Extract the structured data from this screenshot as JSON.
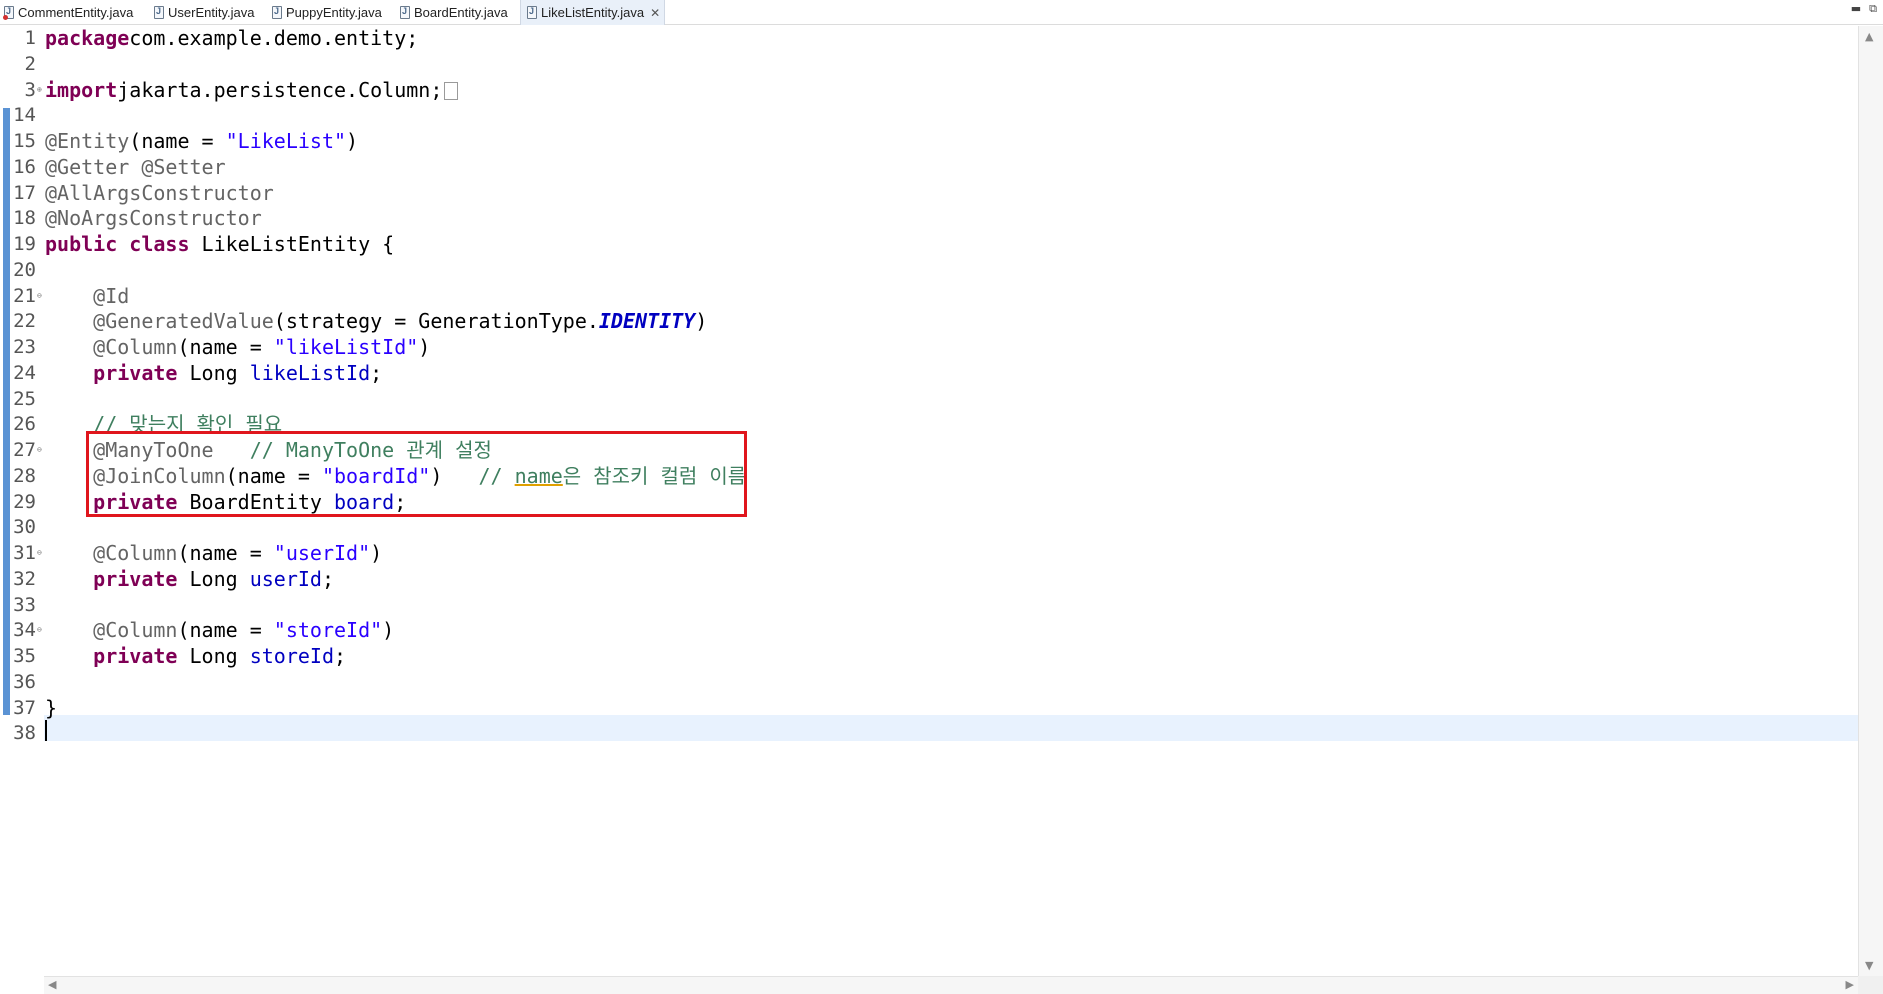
{
  "tabs": [
    {
      "label": "CommentEntity.java",
      "icon": "java-file-error-icon"
    },
    {
      "label": "UserEntity.java",
      "icon": "java-file-icon"
    },
    {
      "label": "PuppyEntity.java",
      "icon": "java-file-icon"
    },
    {
      "label": "BoardEntity.java",
      "icon": "java-file-icon"
    },
    {
      "label": "LikeListEntity.java",
      "icon": "java-file-icon",
      "active": true
    }
  ],
  "window": {
    "minimize": "▬",
    "restore": "⧉",
    "close_tab": "✕"
  },
  "lines": [
    {
      "n": "1",
      "tokens": [
        [
          "kw",
          "package"
        ],
        [
          "",
          "com.example.demo.entity;"
        ]
      ]
    },
    {
      "n": "2",
      "tokens": []
    },
    {
      "n": "3",
      "fold": "+",
      "tokens": [
        [
          "kw",
          "import"
        ],
        [
          "",
          "jakarta.persistence.Column;"
        ]
      ],
      "folded": true
    },
    {
      "n": "14",
      "tokens": []
    },
    {
      "n": "15",
      "tokens": [
        [
          "an",
          "@Entity"
        ],
        [
          "",
          "(name = "
        ],
        [
          "str",
          "\"LikeList\""
        ],
        [
          "",
          ")"
        ]
      ]
    },
    {
      "n": "16",
      "tokens": [
        [
          "an",
          "@Getter @Setter"
        ]
      ]
    },
    {
      "n": "17",
      "tokens": [
        [
          "an",
          "@AllArgsConstructor"
        ]
      ]
    },
    {
      "n": "18",
      "tokens": [
        [
          "an",
          "@NoArgsConstructor"
        ]
      ]
    },
    {
      "n": "19",
      "tokens": [
        [
          "kw",
          "public"
        ],
        [
          "",
          " "
        ],
        [
          "kw",
          "class"
        ],
        [
          "",
          " LikeListEntity {"
        ]
      ]
    },
    {
      "n": "20",
      "tokens": []
    },
    {
      "n": "21",
      "fold": "-",
      "tokens": [
        [
          "",
          "    "
        ],
        [
          "an",
          "@Id"
        ]
      ]
    },
    {
      "n": "22",
      "tokens": [
        [
          "",
          "    "
        ],
        [
          "an",
          "@GeneratedValue"
        ],
        [
          "",
          "(strategy = GenerationType."
        ],
        [
          "cst",
          "IDENTITY"
        ],
        [
          "",
          ")"
        ]
      ]
    },
    {
      "n": "23",
      "tokens": [
        [
          "",
          "    "
        ],
        [
          "an",
          "@Column"
        ],
        [
          "",
          "(name = "
        ],
        [
          "str",
          "\"likeListId\""
        ],
        [
          "",
          ")"
        ]
      ]
    },
    {
      "n": "24",
      "tokens": [
        [
          "",
          "    "
        ],
        [
          "kw",
          "private"
        ],
        [
          "",
          " Long "
        ],
        [
          "fld",
          "likeListId"
        ],
        [
          "",
          ";"
        ]
      ]
    },
    {
      "n": "25",
      "tokens": []
    },
    {
      "n": "26",
      "tokens": [
        [
          "",
          "    "
        ],
        [
          "cm",
          "// 맞는지 확인 필요"
        ]
      ]
    },
    {
      "n": "27",
      "fold": "-",
      "tokens": [
        [
          "",
          "    "
        ],
        [
          "an",
          "@ManyToOne"
        ],
        [
          "",
          "   "
        ],
        [
          "cm",
          "// ManyToOne 관계 설정"
        ]
      ]
    },
    {
      "n": "28",
      "tokens": [
        [
          "",
          "    "
        ],
        [
          "an",
          "@JoinColumn"
        ],
        [
          "",
          "(name = "
        ],
        [
          "str",
          "\"boardId\""
        ],
        [
          "",
          ")   "
        ],
        [
          "cm",
          "// "
        ],
        [
          "cmu",
          "name"
        ],
        [
          "cm",
          "은 참조키 컬럼 이름"
        ]
      ]
    },
    {
      "n": "29",
      "tokens": [
        [
          "",
          "    "
        ],
        [
          "kw",
          "private"
        ],
        [
          "",
          " BoardEntity "
        ],
        [
          "fld",
          "board"
        ],
        [
          "",
          ";"
        ]
      ]
    },
    {
      "n": "30",
      "tokens": []
    },
    {
      "n": "31",
      "fold": "-",
      "tokens": [
        [
          "",
          "    "
        ],
        [
          "an",
          "@Column"
        ],
        [
          "",
          "(name = "
        ],
        [
          "str",
          "\"userId\""
        ],
        [
          "",
          ")"
        ]
      ]
    },
    {
      "n": "32",
      "tokens": [
        [
          "",
          "    "
        ],
        [
          "kw",
          "private"
        ],
        [
          "",
          " Long "
        ],
        [
          "fld",
          "userId"
        ],
        [
          "",
          ";"
        ]
      ]
    },
    {
      "n": "33",
      "tokens": []
    },
    {
      "n": "34",
      "fold": "-",
      "tokens": [
        [
          "",
          "    "
        ],
        [
          "an",
          "@Column"
        ],
        [
          "",
          "(name = "
        ],
        [
          "str",
          "\"storeId\""
        ],
        [
          "",
          ")"
        ]
      ]
    },
    {
      "n": "35",
      "tokens": [
        [
          "",
          "    "
        ],
        [
          "kw",
          "private"
        ],
        [
          "",
          " Long "
        ],
        [
          "fld",
          "storeId"
        ],
        [
          "",
          ";"
        ]
      ]
    },
    {
      "n": "36",
      "tokens": []
    },
    {
      "n": "37",
      "tokens": [
        [
          "",
          "}"
        ]
      ]
    },
    {
      "n": "38",
      "tokens": []
    }
  ],
  "colors": {
    "keyword": "#7f0055",
    "annotation": "#646464",
    "string": "#2a00ff",
    "field": "#0000c0",
    "comment": "#3f7f5f",
    "highlight_box": "#e0161d",
    "change_bar": "#5b93d4",
    "current_line": "#e8f2fe"
  }
}
